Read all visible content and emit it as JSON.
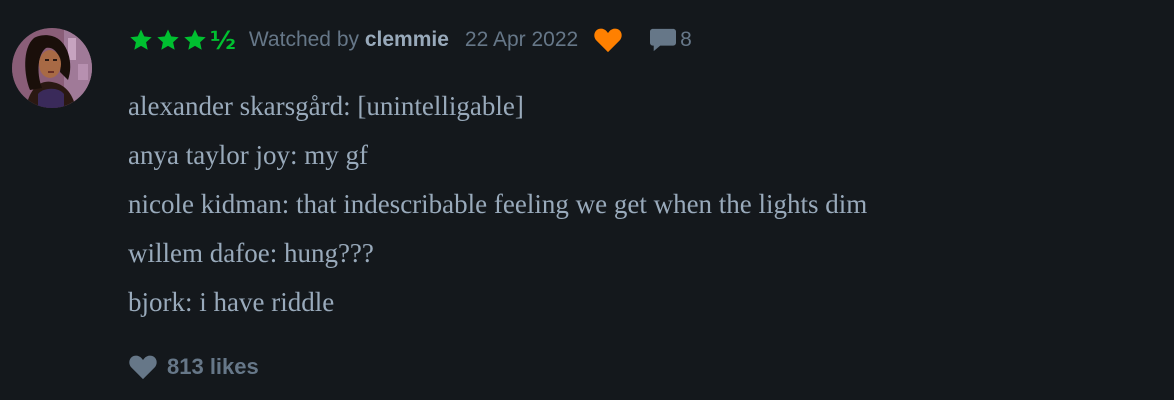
{
  "review": {
    "rating": {
      "stars": 3.5,
      "full_stars": 3,
      "half_glyph": "½",
      "color": "#00c030"
    },
    "watched_prefix": "Watched by",
    "username": "clemmie",
    "date": "22 Apr 2022",
    "liked_icon": "heart-icon",
    "liked_color": "#ff8000",
    "comment_icon": "speech-bubble-icon",
    "comment_count": "8",
    "body_lines": [
      "alexander skarsgård: [unintelligable]",
      "anya taylor joy: my gf",
      "nicole kidman: that indescribable feeling we get when the lights dim",
      "willem dafoe: hung???",
      "bjork: i have riddle"
    ],
    "likes_icon": "heart-icon",
    "likes_label": "813 likes"
  },
  "colors": {
    "background": "#14181c",
    "muted_text": "#667788",
    "body_text": "#99aabb"
  }
}
